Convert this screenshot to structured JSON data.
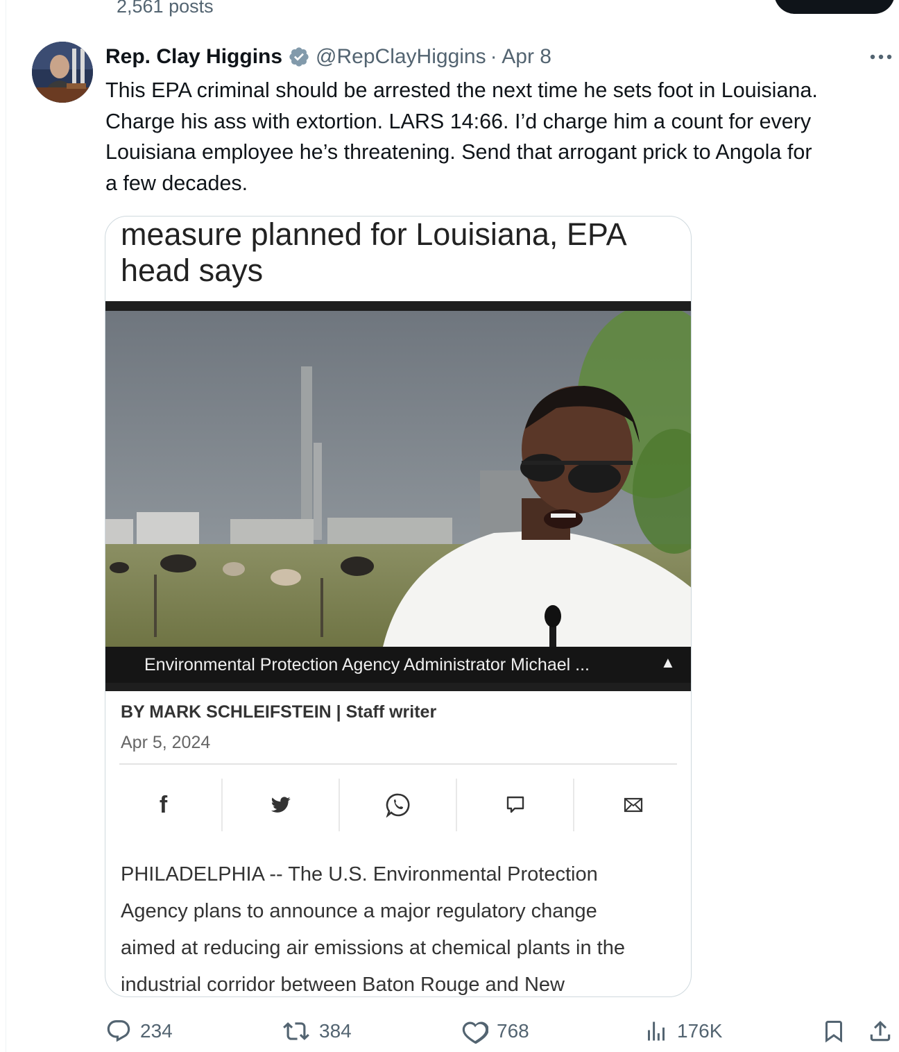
{
  "profile_header": {
    "posts_count": "2,561 posts"
  },
  "tweet": {
    "author_name": "Rep. Clay Higgins",
    "handle": "@RepClayHiggins",
    "date": "· Apr 8",
    "text": "This EPA criminal should be arrested the next time he sets foot in Louisiana.\nCharge his ass with extortion. LARS 14:66. I’d charge him a count for every\nLouisiana employee he’s threatening. Send that arrogant prick to Angola for\na few decades.",
    "icons": {
      "verified": "verified-badge-icon",
      "more": "more-icon"
    }
  },
  "article_card": {
    "headline": "measure planned for Louisiana, EPA\nhead says",
    "photo_caption": "Environmental Protection Agency Administrator Michael ...",
    "caption_toggle": "▲",
    "byline": "BY MARK SCHLEIFSTEIN | Staff writer",
    "date": "Apr 5, 2024",
    "share_icons": [
      "facebook-icon",
      "twitter-icon",
      "whatsapp-icon",
      "comment-icon",
      "email-icon"
    ],
    "facebook_glyph": "f",
    "body": "PHILADELPHIA -- The U.S. Environmental Protection\nAgency plans to announce a major regulatory change\naimed at reducing air emissions at chemical plants in the\nindustrial corridor between Baton Rouge and New"
  },
  "actions": {
    "replies": "234",
    "reposts": "384",
    "likes": "768",
    "views": "176K"
  },
  "colors": {
    "text": "#0f1419",
    "secondary": "#536471",
    "verified": "#829aab",
    "border": "#cfd9de"
  }
}
